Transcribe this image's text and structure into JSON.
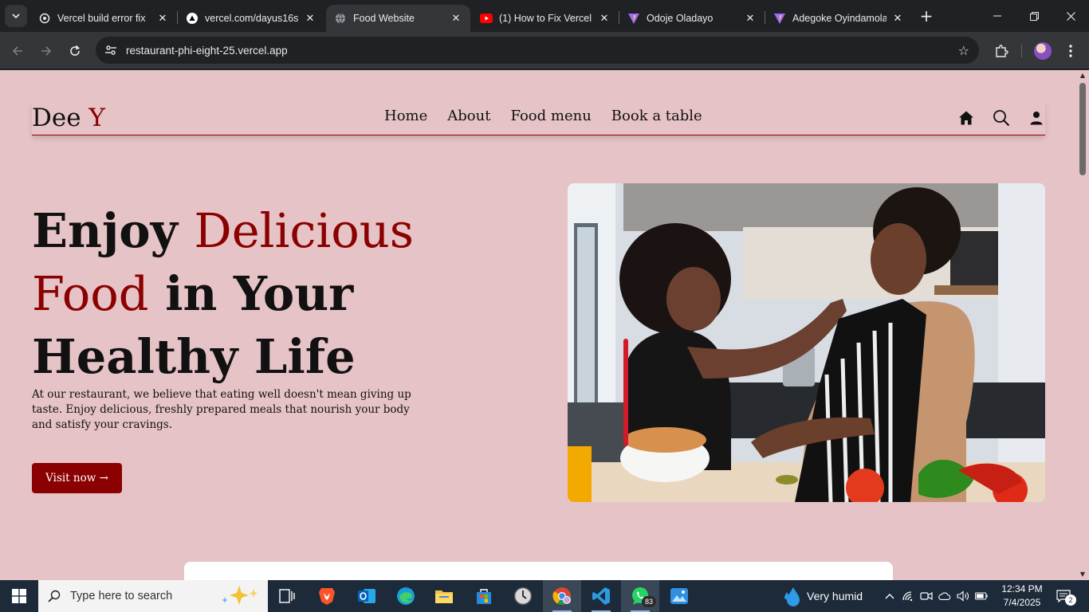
{
  "browser": {
    "tabs": [
      {
        "title": "Vercel build error fix",
        "icon": "openai-icon",
        "active": false
      },
      {
        "title": "vercel.com/dayus16s",
        "icon": "vercel-icon",
        "active": false
      },
      {
        "title": "Food Website",
        "icon": "globe-icon",
        "active": true
      },
      {
        "title": "(1) How to Fix Vercel",
        "icon": "youtube-icon",
        "active": false
      },
      {
        "title": "Odoje Oladayo",
        "icon": "vite-icon",
        "active": false
      },
      {
        "title": "Adegoke Oyindamola",
        "icon": "vite-icon",
        "active": false
      }
    ],
    "url": "restaurant-phi-eight-25.vercel.app"
  },
  "site": {
    "logo_main": "Dee",
    "logo_accent": "Y",
    "nav": [
      "Home",
      "About",
      "Food menu",
      "Book a table"
    ],
    "hero": {
      "title_part1": "Enjoy ",
      "title_part2": "Delicious Food",
      "title_part3": " in Your Healthy Life",
      "description": "At our restaurant, we believe that eating well doesn't mean giving up taste. Enjoy delicious, freshly prepared meals that nourish your body and satisfy your cravings.",
      "button": "Visit now →",
      "image": "photo of a woman feeding a man pasta in a kitchen"
    },
    "colors": {
      "accent": "#8b0000",
      "background": "#e6c3c6"
    }
  },
  "taskbar": {
    "search_placeholder": "Type here to search",
    "whatsapp_badge": "83",
    "weather": "Very humid",
    "time": "12:34 PM",
    "date": "7/4/2025",
    "notifications": "2"
  }
}
